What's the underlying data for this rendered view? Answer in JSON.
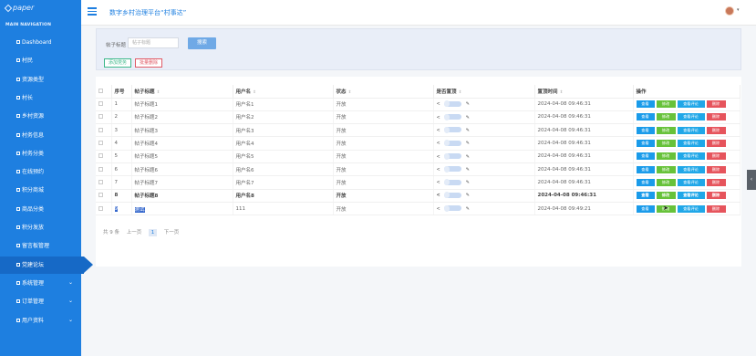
{
  "sidebar": {
    "logo": "paper",
    "section_title": "MAIN NAVIGATION",
    "items": [
      {
        "label": "Dashboard",
        "icon": "dashboard-icon",
        "expand": ""
      },
      {
        "label": "村民",
        "icon": "grid-icon",
        "expand": ""
      },
      {
        "label": "资源类型",
        "icon": "grid-icon",
        "expand": ""
      },
      {
        "label": "村长",
        "icon": "grid-icon",
        "expand": ""
      },
      {
        "label": "乡村资源",
        "icon": "grid-icon",
        "expand": ""
      },
      {
        "label": "村务信息",
        "icon": "grid-icon",
        "expand": ""
      },
      {
        "label": "村务分类",
        "icon": "grid-icon",
        "expand": ""
      },
      {
        "label": "在线预约",
        "icon": "grid-icon",
        "expand": ""
      },
      {
        "label": "积分商城",
        "icon": "grid-icon",
        "expand": ""
      },
      {
        "label": "商品分类",
        "icon": "grid-icon",
        "expand": ""
      },
      {
        "label": "积分发放",
        "icon": "grid-icon",
        "expand": ""
      },
      {
        "label": "留言板管理",
        "icon": "grid-icon",
        "expand": ""
      },
      {
        "label": "党建论坛",
        "icon": "list-icon",
        "expand": "",
        "active": true
      },
      {
        "label": "系统管理",
        "icon": "grid-icon",
        "expand": "⌄"
      },
      {
        "label": "订单管理",
        "icon": "grid-icon",
        "expand": "⌄"
      },
      {
        "label": "用户资料",
        "icon": "user-icon",
        "expand": "⌄"
      }
    ]
  },
  "header": {
    "title": "数字乡村治理平台“村事达”"
  },
  "search": {
    "label": "帖子标题",
    "placeholder": "帖子标题",
    "search_button": "搜索",
    "add_button": "添加党务",
    "batch_delete_button": "批量删除"
  },
  "table": {
    "columns": [
      "",
      "序号",
      "帖子标题",
      "用户名",
      "状态",
      "是否置顶",
      "置顶时间",
      "操作"
    ],
    "actions": {
      "view": "查看",
      "edit": "修改",
      "comments": "查看评论",
      "delete": "删除"
    },
    "rows": [
      {
        "no": "1",
        "title": "帖子标题1",
        "user": "用户名1",
        "status": "开放",
        "time": "2024-04-08 09:46:31",
        "bold": false
      },
      {
        "no": "2",
        "title": "帖子标题2",
        "user": "用户名2",
        "status": "开放",
        "time": "2024-04-08 09:46:31",
        "bold": false
      },
      {
        "no": "3",
        "title": "帖子标题3",
        "user": "用户名3",
        "status": "开放",
        "time": "2024-04-08 09:46:31",
        "bold": false
      },
      {
        "no": "4",
        "title": "帖子标题4",
        "user": "用户名4",
        "status": "开放",
        "time": "2024-04-08 09:46:31",
        "bold": false
      },
      {
        "no": "5",
        "title": "帖子标题5",
        "user": "用户名5",
        "status": "开放",
        "time": "2024-04-08 09:46:31",
        "bold": false
      },
      {
        "no": "6",
        "title": "帖子标题6",
        "user": "用户名6",
        "status": "开放",
        "time": "2024-04-08 09:46:31",
        "bold": false
      },
      {
        "no": "7",
        "title": "帖子标题7",
        "user": "用户名7",
        "status": "开放",
        "time": "2024-04-08 09:46:31",
        "bold": false
      },
      {
        "no": "8",
        "title": "帖子标题8",
        "user": "用户名8",
        "status": "开放",
        "time": "2024-04-08 09:46:31",
        "bold": true
      },
      {
        "no": "9",
        "title": "测试",
        "user": "111",
        "status": "开放",
        "time": "2024-04-08 09:49:21",
        "bold": false,
        "selected": true
      }
    ]
  },
  "pagination": {
    "total": "共 9 条",
    "prev": "上一页",
    "current": "1",
    "next": "下一页"
  },
  "colors": {
    "sidebar": "#1e7fe0",
    "view_button": "#1a9bea",
    "edit_button": "#67c23a",
    "delete_button": "#e6545c"
  }
}
